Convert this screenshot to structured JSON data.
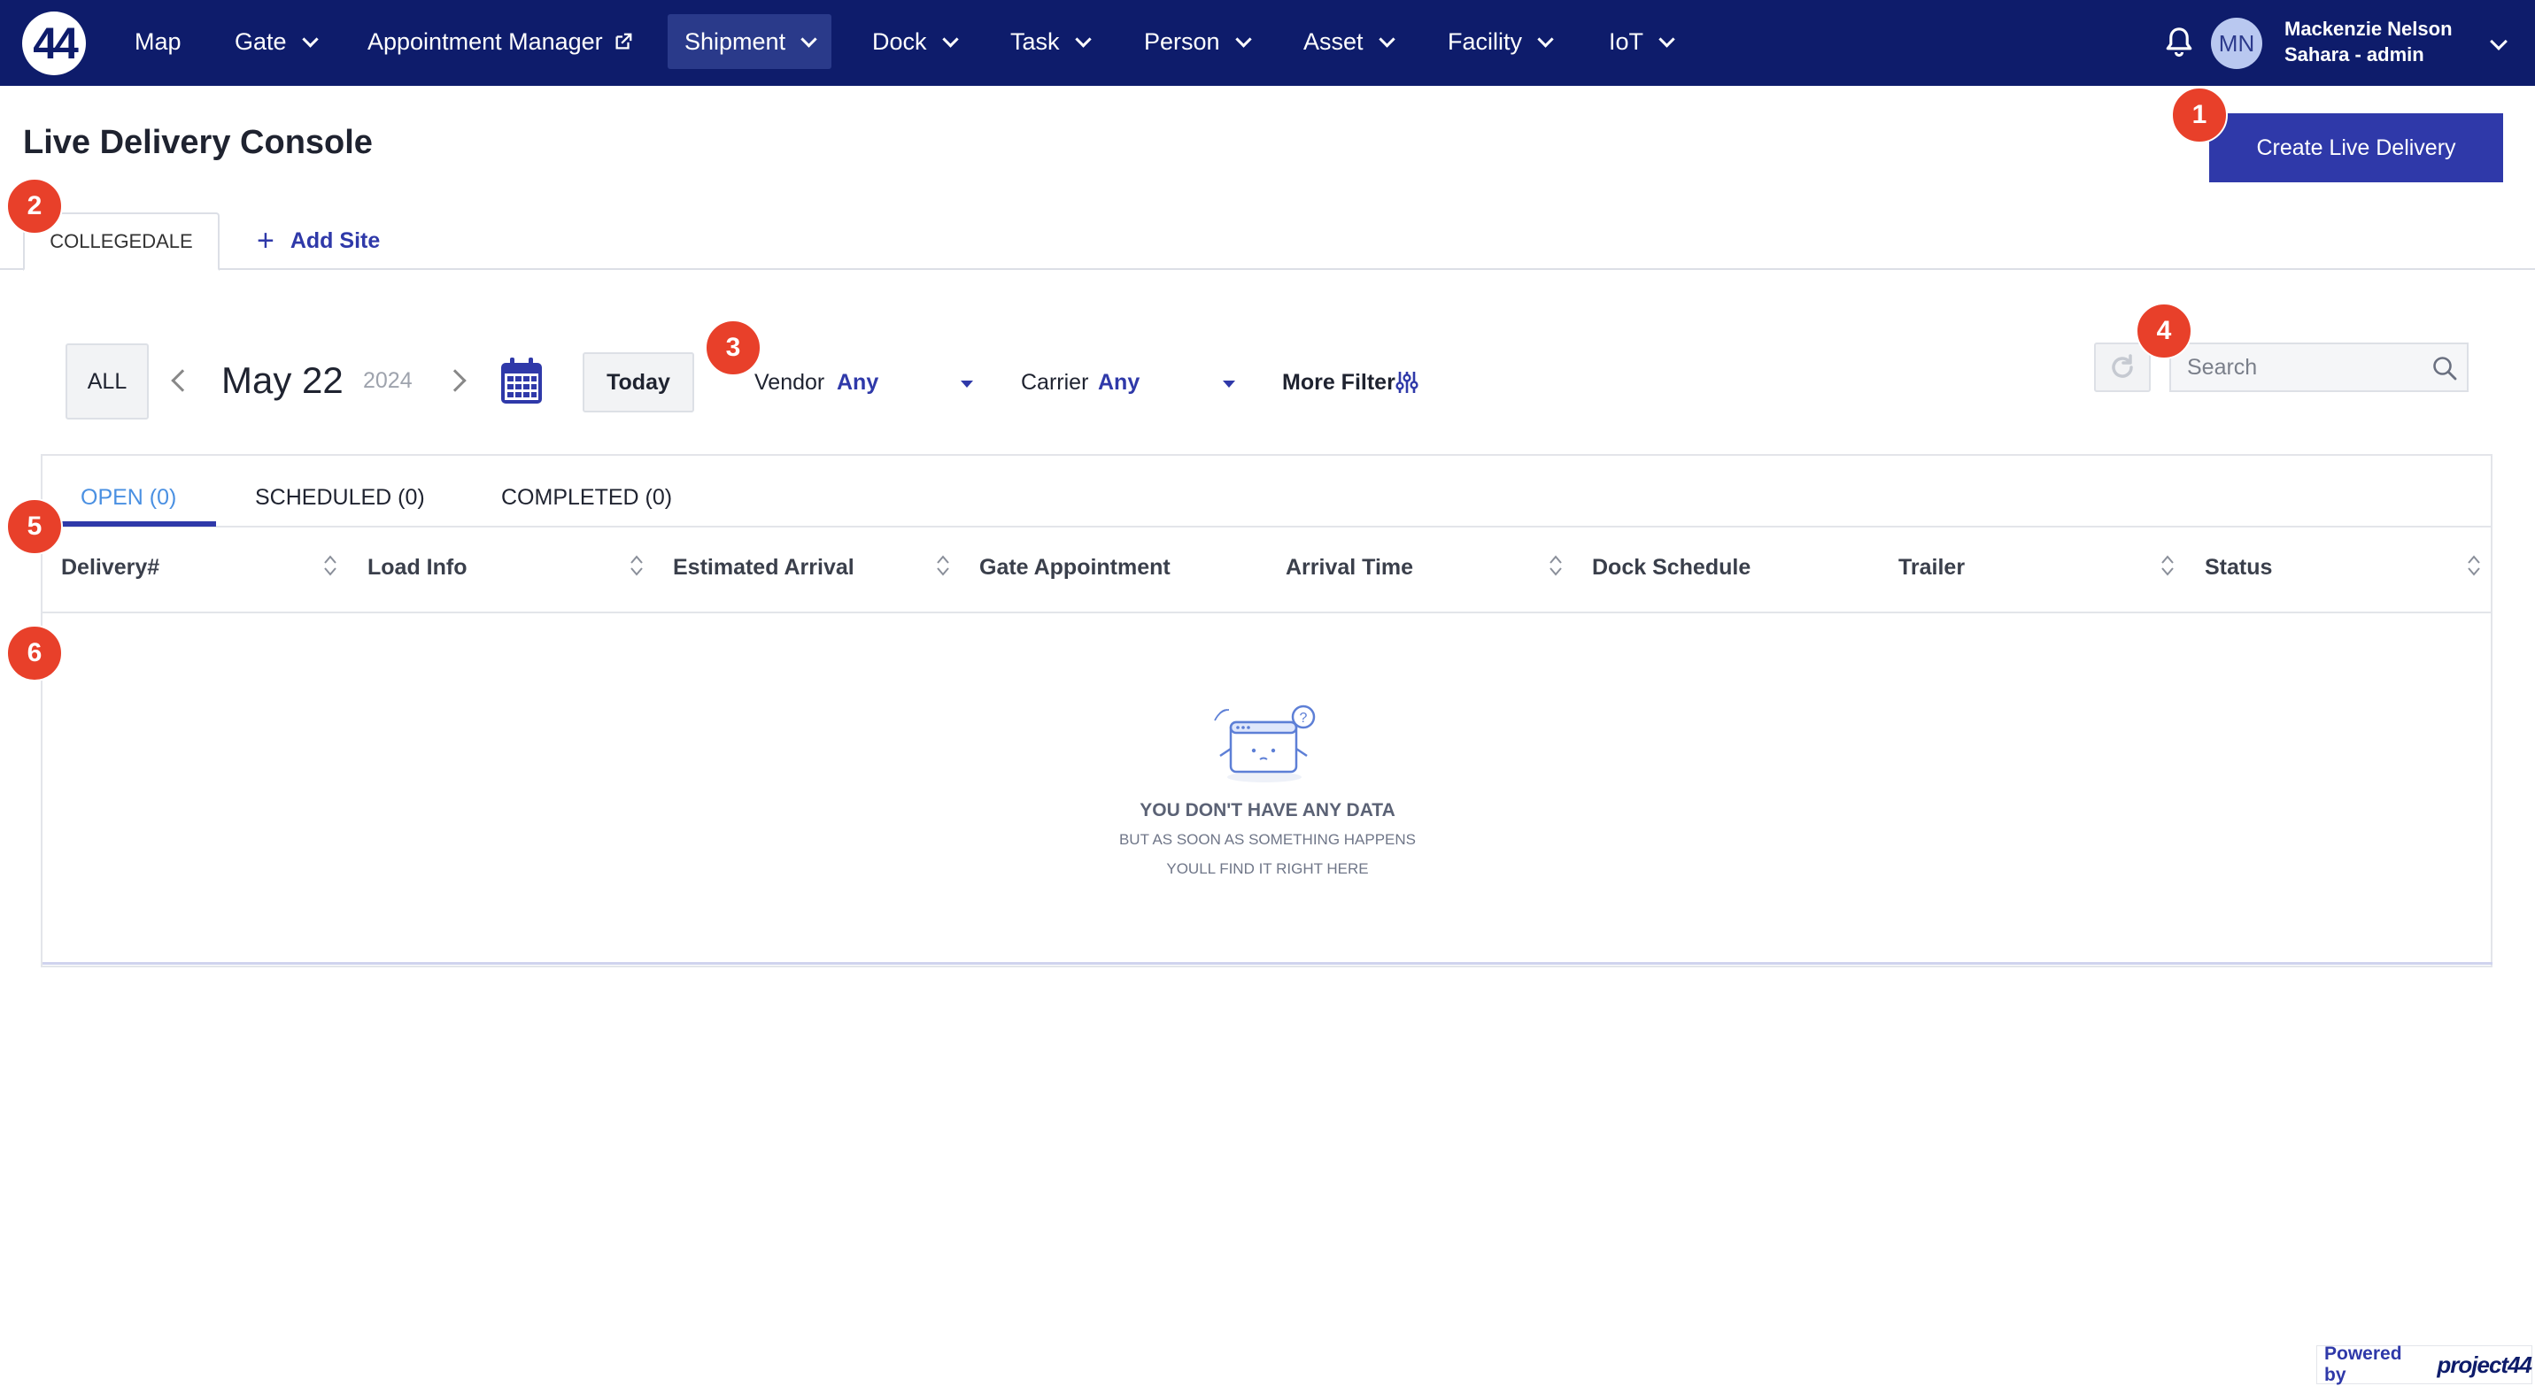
{
  "brand": {
    "logo_text": "44"
  },
  "nav": {
    "items": [
      {
        "label": "Map"
      },
      {
        "label": "Gate"
      },
      {
        "label": "Appointment Manager"
      },
      {
        "label": "Shipment"
      },
      {
        "label": "Dock"
      },
      {
        "label": "Task"
      },
      {
        "label": "Person"
      },
      {
        "label": "Asset"
      },
      {
        "label": "Facility"
      },
      {
        "label": "IoT"
      }
    ],
    "active": "Shipment"
  },
  "user": {
    "initials": "MN",
    "name": "Mackenzie Nelson",
    "role": "Sahara - admin"
  },
  "header": {
    "title": "Live Delivery Console",
    "create_label": "Create Live Delivery"
  },
  "sites": {
    "tabs": [
      {
        "label": "COLLEGEDALE"
      }
    ],
    "add_label": "Add Site"
  },
  "toolbar": {
    "all_label": "ALL",
    "date": "May 22",
    "year": "2024",
    "today_label": "Today",
    "vendor_label": "Vendor",
    "vendor_value": "Any",
    "carrier_label": "Carrier",
    "carrier_value": "Any",
    "more_filter_label": "More Filter",
    "search_placeholder": "Search"
  },
  "status_tabs": [
    {
      "label": "OPEN (0)"
    },
    {
      "label": "SCHEDULED (0)"
    },
    {
      "label": "COMPLETED (0)"
    }
  ],
  "table": {
    "columns": [
      {
        "label": "Delivery#"
      },
      {
        "label": "Load Info"
      },
      {
        "label": "Estimated Arrival"
      },
      {
        "label": "Gate Appointment"
      },
      {
        "label": "Arrival Time"
      },
      {
        "label": "Dock Schedule"
      },
      {
        "label": "Trailer"
      },
      {
        "label": "Status"
      }
    ]
  },
  "empty_state": {
    "title": "YOU DON'T HAVE ANY DATA",
    "line1": "BUT AS SOON AS SOMETHING HAPPENS",
    "line2": "YOULL FIND IT RIGHT HERE"
  },
  "callouts": [
    "1",
    "2",
    "3",
    "4",
    "5",
    "6"
  ],
  "footer": {
    "powered_label": "Powered by",
    "brand": "project44"
  },
  "colors": {
    "nav_bg": "#0e1c6b",
    "accent": "#2f39a9",
    "active_tab_text": "#4a90e2",
    "badge": "#e8402a"
  }
}
